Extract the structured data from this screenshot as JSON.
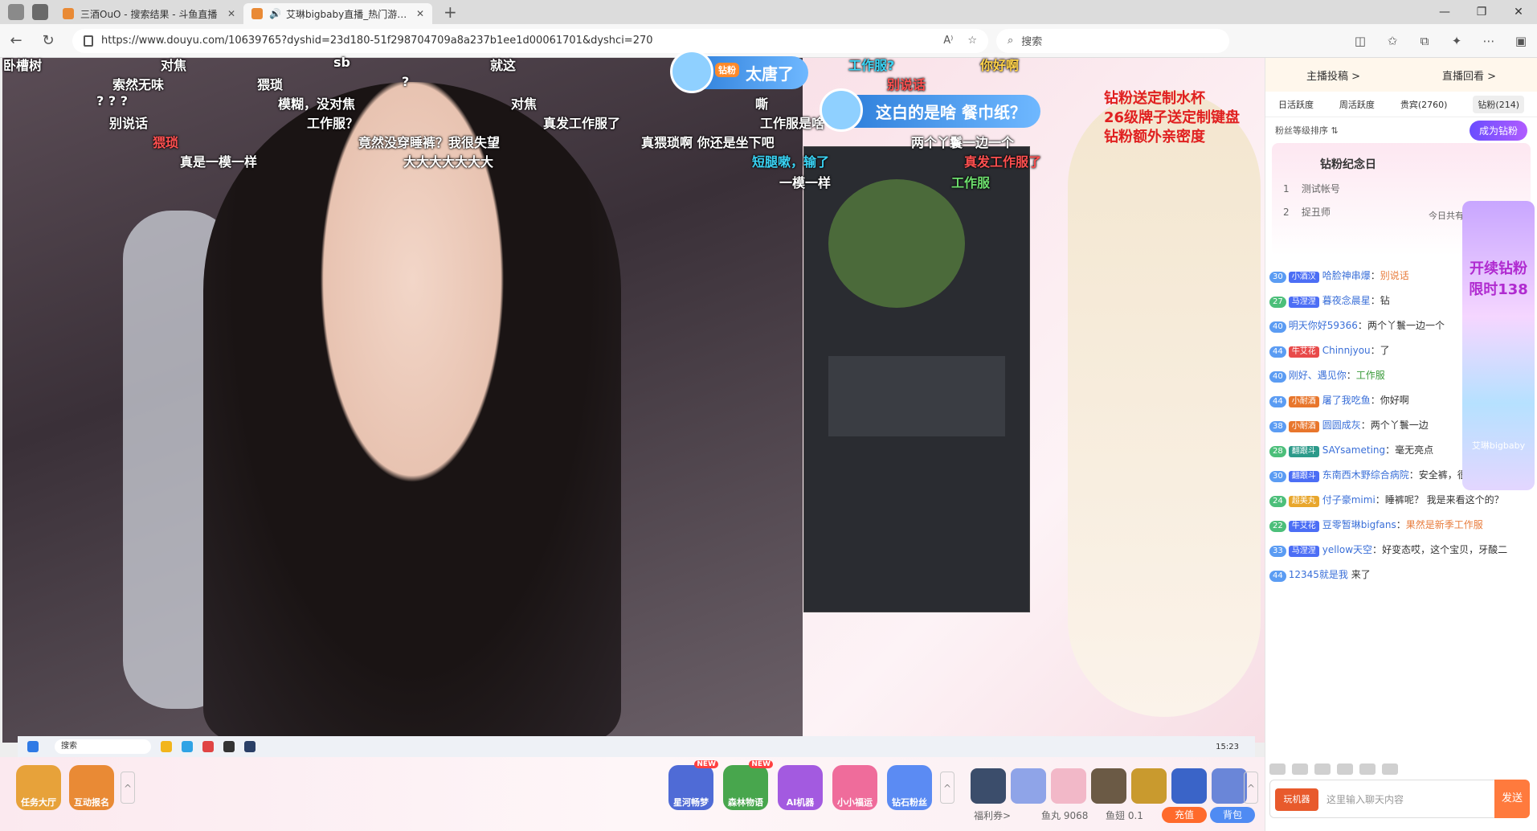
{
  "browser": {
    "tabs": [
      {
        "title": "三酒OuO - 搜索结果 - 斗鱼直播",
        "active": false
      },
      {
        "title": "艾琳bigbaby直播_热门游戏直播",
        "active": true
      }
    ],
    "url": "https://www.douyu.com/10639765?dyshid=23d180-51f298704709a8a237b1ee1d00061701&dyshci=270",
    "search_placeholder": "搜索"
  },
  "stream": {
    "danmu": [
      {
        "text": "卧槽树",
        "color": "w"
      },
      {
        "text": "对焦",
        "color": "w"
      },
      {
        "text": "sb",
        "color": "w"
      },
      {
        "text": "就这",
        "color": "w"
      },
      {
        "text": "索然无味",
        "color": "w"
      },
      {
        "text": "猥琐",
        "color": "w"
      },
      {
        "text": "?",
        "color": "w"
      },
      {
        "text": "模糊，没对焦",
        "color": "w"
      },
      {
        "text": "? ? ?",
        "color": "w"
      },
      {
        "text": "对焦",
        "color": "w"
      },
      {
        "text": "嘶",
        "color": "w"
      },
      {
        "text": "工作服？",
        "color": "w"
      },
      {
        "text": "别说话",
        "color": "w"
      },
      {
        "text": "真发工作服了",
        "color": "w"
      },
      {
        "text": "工作服是啥",
        "color": "w"
      },
      {
        "text": "猥琐",
        "color": "r"
      },
      {
        "text": "竟然没穿睡裤？我很失望",
        "color": "w"
      },
      {
        "text": "真猥琐啊 你还是坐下吧",
        "color": "w"
      },
      {
        "text": "真是一模一样",
        "color": "w"
      },
      {
        "text": "大大大大大大大",
        "color": "w"
      },
      {
        "text": "短腿嗽，输了",
        "color": "c"
      },
      {
        "text": "一模一样",
        "color": "w"
      },
      {
        "text": "工作服?",
        "color": "c"
      },
      {
        "text": "你好啊",
        "color": "y"
      },
      {
        "text": "两个丫鬟一边一个",
        "color": "w"
      },
      {
        "text": "别说话",
        "color": "r"
      },
      {
        "text": "真发工作服了",
        "color": "r"
      },
      {
        "text": "工作服",
        "color": "g"
      }
    ],
    "super_danmu": [
      {
        "tag": "钻粉",
        "text": "太唐了"
      },
      {
        "tag": "钻粉",
        "text": "这白的是啥 餐巾纸？"
      }
    ],
    "annotation": [
      "钻粉送定制水杯",
      "26级牌子送定制键盘",
      "钻粉额外亲密度"
    ],
    "taskbar_search": "搜索",
    "taskbar_time": "15:23"
  },
  "bottom": {
    "icons": [
      {
        "label": "任务大厅",
        "color": "#e7a23a"
      },
      {
        "label": "互动报名",
        "color": "#e98a35"
      }
    ],
    "activity_icons": [
      {
        "label": "星河畅梦",
        "new": "NEW",
        "color": "#4f6bd6"
      },
      {
        "label": "森林物语",
        "new": "NEW",
        "color": "#48a64d"
      },
      {
        "label": "AI机器",
        "new": "",
        "color": "#a35ae0"
      },
      {
        "label": "小小福运",
        "new": "",
        "color": "#ef6c9b"
      },
      {
        "label": "钻石粉丝",
        "new": "",
        "color": "#5b8bf3"
      }
    ],
    "info": {
      "welfare": "福利券>",
      "fishball": "鱼丸 9068",
      "fishwing": "鱼翅 0.1",
      "recharge": "充值",
      "bag": "背包"
    }
  },
  "sidebar": {
    "top_tabs": [
      "主播投稿 >",
      "直播回看 >"
    ],
    "rank_tabs": [
      "日活跃度",
      "周活跃度",
      "贵宾(2760)",
      "钻粉(214)"
    ],
    "fan_rank": "粉丝等级排序 ⇅",
    "become_fan": "成为钻粉",
    "fan_day": "钻粉纪念日",
    "today": "今日共有10位粉丝",
    "ranks": [
      {
        "n": "1",
        "name": "测试帐号"
      },
      {
        "n": "2",
        "name": "捉丑师"
      }
    ],
    "promo": {
      "title": "开续钻粉 限时138",
      "host": "艾琳bigbaby"
    },
    "chat": [
      {
        "lv": "30",
        "badge": "小酒汉",
        "user": "哈脸神串爆",
        "text": "别说话"
      },
      {
        "lv": "27",
        "badge": "马涅涅",
        "user": "暮夜念晨星",
        "text": "钻"
      },
      {
        "lv": "40",
        "badge": "",
        "user": "明天你好59366",
        "text": "两个丫鬟一边一个"
      },
      {
        "lv": "44",
        "badge": "牛艾花",
        "user": "Chinnjyou",
        "text": "了"
      },
      {
        "lv": "40",
        "badge": "",
        "user": "刚好、遇见你",
        "text": "工作服"
      },
      {
        "lv": "44",
        "badge": "小耐酒",
        "user": "屠了我吃鱼",
        "text": "你好啊"
      },
      {
        "lv": "38",
        "badge": "小耐酒",
        "user": "圆圆成灰",
        "text": "两个丫鬟一边"
      },
      {
        "lv": "28",
        "badge": "翻跟斗",
        "user": "SAYsameting",
        "text": "毫无亮点"
      },
      {
        "lv": "30",
        "badge": "翻跟斗",
        "user": "东南西木野综合病院",
        "text": "安全裤，很失望。"
      },
      {
        "lv": "24",
        "badge": "超美丸",
        "user": "付子豪mimi",
        "text": "睡裤呢？ 我是来看这个的？"
      },
      {
        "lv": "22",
        "badge": "牛艾花",
        "user": "豆零暂琳bigfans",
        "text": "果然是新季工作服"
      },
      {
        "lv": "33",
        "badge": "马涅涅",
        "user": "yellow天空",
        "text": "好变态哎，这个宝贝，牙酸二"
      },
      {
        "lv": "44",
        "badge": "",
        "user": "12345就是我",
        "text": "来了"
      }
    ],
    "input_placeholder": "这里输入聊天内容",
    "send": "发送",
    "play_btn": "玩机器"
  }
}
